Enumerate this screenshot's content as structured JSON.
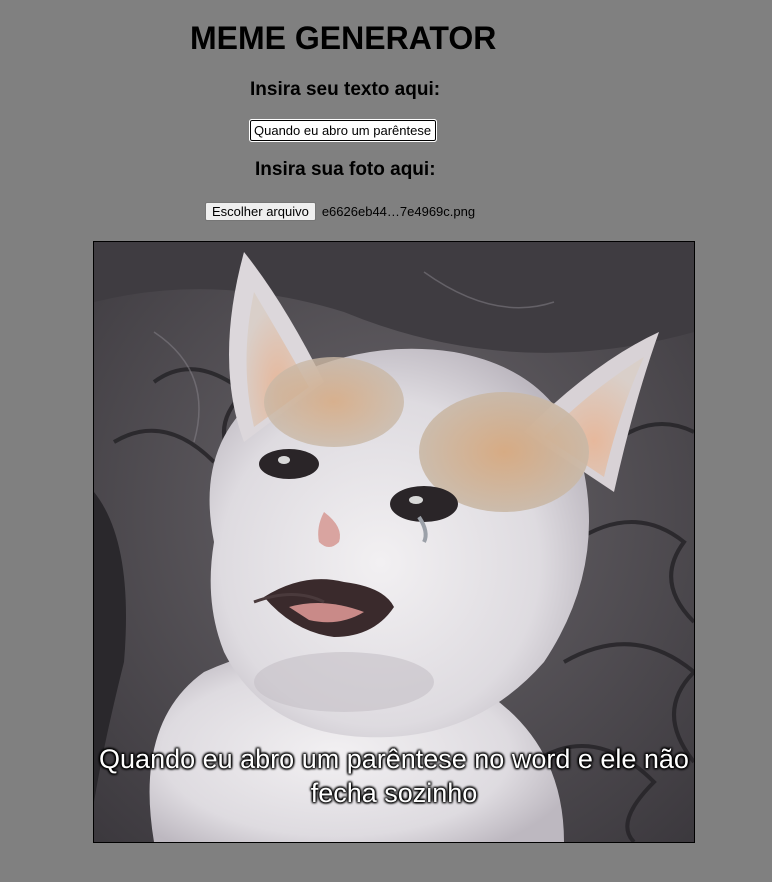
{
  "header": {
    "title": "MEME GENERATOR"
  },
  "form": {
    "text_label": "Insira seu texto aqui:",
    "text_input_value": "Quando eu abro um parêntese no word e ele não fecha sozinho",
    "photo_label": "Insira sua foto aqui:",
    "file_button_label": "Escolher arquivo",
    "file_name": "e6626eb44…7e4969c.png"
  },
  "meme": {
    "caption": "Quando eu abro um parêntese no word e ele não fecha sozinho"
  },
  "colors": {
    "page_background": "#808080"
  }
}
